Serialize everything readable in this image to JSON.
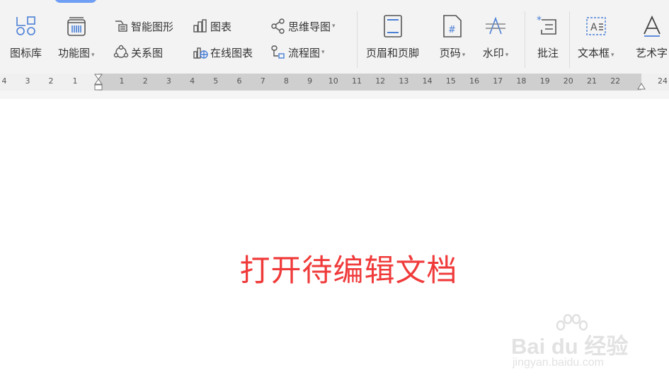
{
  "ribbon": {
    "big_buttons": [
      {
        "label": "图标库",
        "icon": "icon-library-icon"
      },
      {
        "label": "功能图",
        "icon": "function-chart-icon"
      },
      {
        "label": "页眉和页脚",
        "icon": "header-footer-icon"
      },
      {
        "label": "页码",
        "icon": "page-number-icon"
      },
      {
        "label": "水印",
        "icon": "watermark-icon"
      },
      {
        "label": "批注",
        "icon": "comment-icon"
      },
      {
        "label": "文本框",
        "icon": "text-box-icon"
      },
      {
        "label": "艺术字",
        "icon": "word-art-icon"
      }
    ],
    "small_buttons": [
      {
        "label": "智能图形",
        "icon": "smart-graphic-icon"
      },
      {
        "label": "关系图",
        "icon": "relationship-chart-icon"
      },
      {
        "label": "图表",
        "icon": "chart-icon"
      },
      {
        "label": "在线图表",
        "icon": "online-chart-icon"
      },
      {
        "label": "思维导图",
        "icon": "mind-map-icon"
      },
      {
        "label": "流程图",
        "icon": "flowchart-icon"
      }
    ],
    "caret": "▾"
  },
  "ruler": {
    "ticks": [
      "4",
      "3",
      "2",
      "1",
      "1",
      "2",
      "3",
      "4",
      "5",
      "6",
      "7",
      "8",
      "9",
      "10",
      "11",
      "12",
      "13",
      "14",
      "15",
      "16",
      "17",
      "18",
      "19",
      "20",
      "21",
      "22",
      "24"
    ]
  },
  "document": {
    "text": "打开待编辑文档",
    "text_color": "#f03a3a"
  },
  "watermark": {
    "logo": "Bai du 经验",
    "url": "jingyan.baidu.com"
  }
}
